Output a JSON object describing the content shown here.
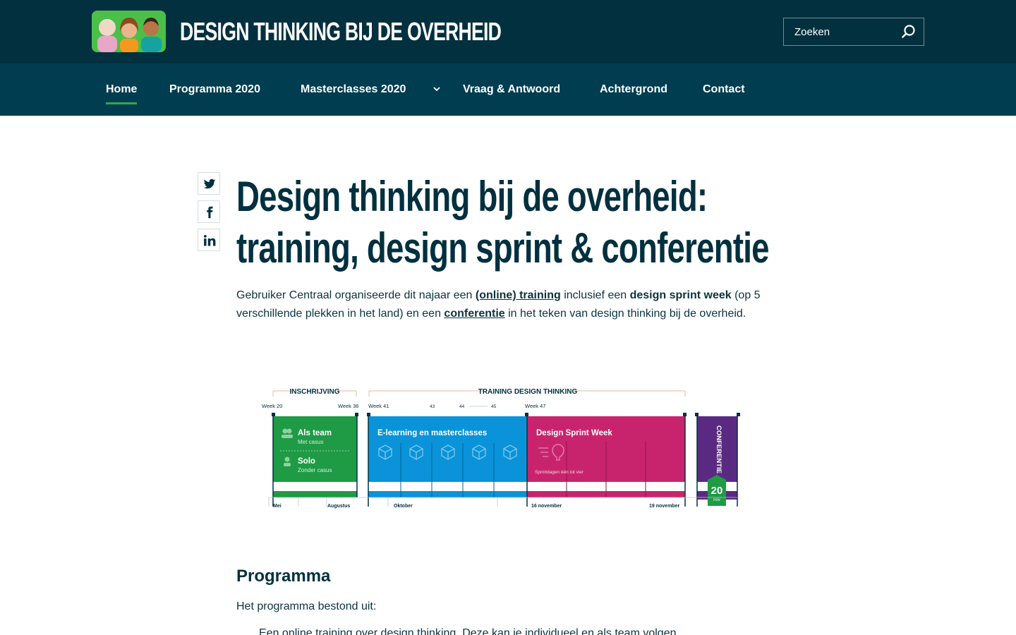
{
  "header": {
    "site_title": "DESIGN THINKING BIJ DE OVERHEID",
    "search_placeholder": "Zoeken",
    "colors": {
      "topbar": "#02303f",
      "navbar": "#003d50",
      "active_underline": "#2fa84f"
    }
  },
  "nav": {
    "items": [
      {
        "label": "Home"
      },
      {
        "label": "Programma 2020"
      },
      {
        "label": "Masterclasses 2020"
      },
      {
        "label": "Vraag & Antwoord"
      },
      {
        "label": "Achtergrond"
      },
      {
        "label": "Contact"
      }
    ],
    "active": "Home"
  },
  "share": {
    "icons": [
      "twitter-icon",
      "facebook-icon",
      "linkedin-icon"
    ]
  },
  "article": {
    "title": "Design thinking bij de overheid: training, design sprint & conferentie",
    "intro": {
      "p1": "Gebruiker Centraal organiseerde dit najaar een ",
      "link1": "(online) training",
      "p2": " inclusief een ",
      "bold1": "design sprint week",
      "p3": " (op 5 verschillende plekken in het land) en een ",
      "link2": "conferentie",
      "p4": " in het teken van design thinking bij de overheid."
    },
    "timeline": {
      "headers": {
        "left": "INSCHRIJVING",
        "right": "TRAINING DESIGN THINKING"
      },
      "weeks": [
        "Week 20",
        "Week 36",
        "Week 41",
        "43",
        "44",
        "45",
        "Week 47"
      ],
      "months": [
        "Mei",
        "Augustus",
        "Oktober",
        "16 november",
        "19 november"
      ],
      "team_title": "Als team",
      "team_sub": "Met casus",
      "solo_title": "Solo",
      "solo_sub": "Zonder casus",
      "elearning": "E-learning en masterclasses",
      "sprint": "Design Sprint Week",
      "sprint_sub": "Sprintdagen één tot vier",
      "conference": "CONFERENTIE",
      "date_day": "20",
      "date_month": "nov",
      "colors": {
        "green": "#1f9a45",
        "blue": "#0a93d8",
        "pink": "#c8246e",
        "purple": "#5a2a82"
      }
    },
    "section_title": "Programma",
    "section_text": "Het programma bestond uit:",
    "bullet_1": "Een online training over design thinking. Deze kan je individueel en als team volgen."
  }
}
